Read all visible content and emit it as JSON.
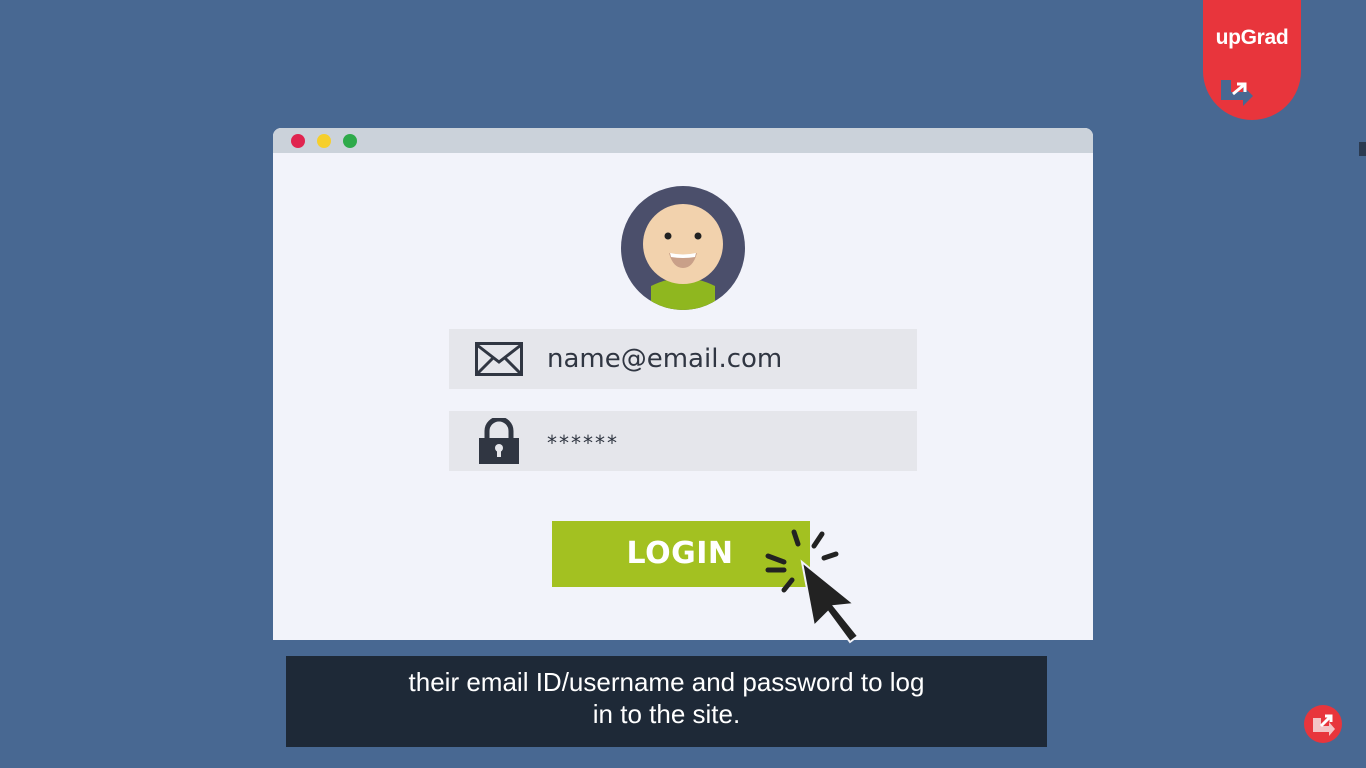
{
  "brand": {
    "name": "upGrad",
    "color": "#e8353c"
  },
  "window": {
    "controls": [
      "close-dot",
      "minimize-dot",
      "maximize-dot"
    ],
    "colors": {
      "close": "#e0244f",
      "minimize": "#f6cf2c",
      "maximize": "#2eaa4a"
    }
  },
  "login_form": {
    "email_icon": "envelope-icon",
    "email_value": "name@email.com",
    "password_icon": "lock-icon",
    "password_value": "******",
    "button_label": "LOGIN",
    "button_color": "#a3c121"
  },
  "subtitle": {
    "line1": "their email ID/username and password to log",
    "line2": "in to the site."
  }
}
